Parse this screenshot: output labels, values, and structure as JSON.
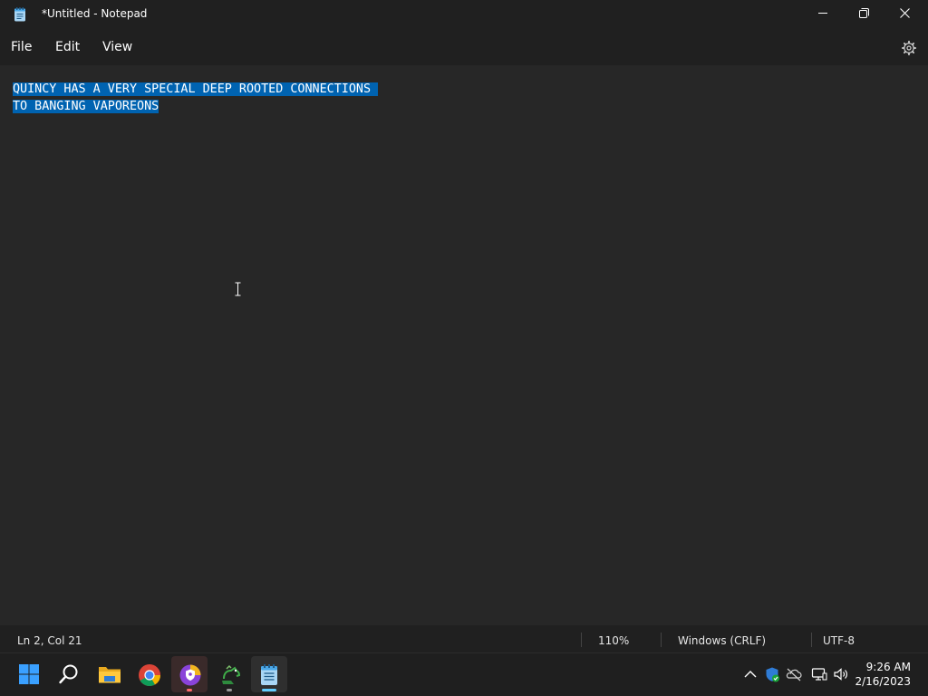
{
  "window": {
    "title": "*Untitled - Notepad",
    "app_icon": "notepad-icon",
    "controls": [
      "minimize-icon",
      "restore-icon",
      "close-icon"
    ]
  },
  "menu": {
    "items": [
      {
        "label": "File"
      },
      {
        "label": "Edit"
      },
      {
        "label": "View"
      }
    ],
    "settings_icon": "gear-icon"
  },
  "editor": {
    "lines": [
      "QUINCY HAS A VERY SPECIAL DEEP ROOTED CONNECTIONS",
      "TO BANGING VAPOREONS"
    ],
    "selection_color": "#0063b1",
    "all_selected": true
  },
  "status": {
    "position": "Ln 2, Col 21",
    "zoom": "110%",
    "line_ending": "Windows (CRLF)",
    "encoding": "UTF-8"
  },
  "taskbar": {
    "apps": [
      {
        "icon": "windows-start-icon"
      },
      {
        "icon": "search-icon"
      },
      {
        "icon": "file-explorer-icon"
      },
      {
        "icon": "chrome-icon"
      },
      {
        "icon": "browser-shield-icon",
        "running": true
      },
      {
        "icon": "python-app-icon",
        "running": true
      },
      {
        "icon": "notepad-icon",
        "active": true
      }
    ],
    "tray": [
      "chevron-up-icon",
      "security-shield-icon",
      "onedrive-offline-icon",
      "network-icon",
      "volume-icon"
    ],
    "time": "9:26 AM",
    "date": "2/16/2023",
    "accent": "#60cdff"
  }
}
